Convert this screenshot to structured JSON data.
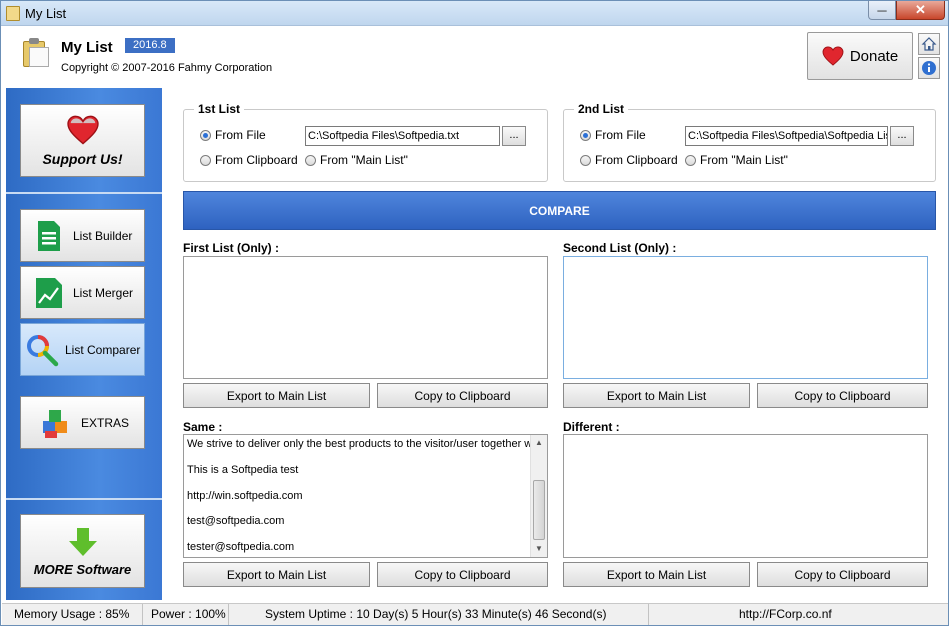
{
  "window": {
    "title": "My List",
    "minimize_glyph": "─",
    "close_glyph": "✕"
  },
  "header": {
    "app_name": "My List",
    "version": "2016.8",
    "copyright": "Copyright © 2007-2016 Fahmy Corporation",
    "donate_label": "Donate"
  },
  "sidebar": {
    "support_label": "Support Us!",
    "items": [
      {
        "label": "List Builder",
        "icon": "sheet-icon"
      },
      {
        "label": "List Merger",
        "icon": "chart-icon"
      },
      {
        "label": "List Comparer",
        "icon": "magnifier-icon",
        "active": true
      },
      {
        "label": "EXTRAS",
        "icon": "cubes-icon"
      }
    ],
    "more_label": "MORE Software"
  },
  "list1": {
    "title": "1st List",
    "from_file": "From File",
    "from_clipboard": "From Clipboard",
    "from_main": "From \"Main List\"",
    "path": "C:\\Softpedia Files\\Softpedia.txt",
    "browse": "..."
  },
  "list2": {
    "title": "2nd List",
    "from_file": "From File",
    "from_clipboard": "From Clipboard",
    "from_main": "From \"Main List\"",
    "path": "C:\\Softpedia Files\\Softpedia\\Softpedia List",
    "browse": "..."
  },
  "compare_label": "COMPARE",
  "first_only": {
    "label": "First List (Only) :",
    "export": "Export to Main List",
    "copy": "Copy to Clipboard"
  },
  "second_only": {
    "label": "Second List (Only) :",
    "export": "Export to Main List",
    "copy": "Copy to Clipboard"
  },
  "same": {
    "label": "Same :",
    "lines": [
      "We strive to deliver only the best products to the visitor/user together with",
      "This is a Softpedia test",
      "http://win.softpedia.com",
      "test@softpedia.com",
      "tester@softpedia.com"
    ],
    "export": "Export to Main List",
    "copy": "Copy to Clipboard"
  },
  "different": {
    "label": "Different :",
    "export": "Export to Main List",
    "copy": "Copy to Clipboard"
  },
  "status": {
    "memory": "Memory Usage : 85%",
    "power": "Power : 100%",
    "uptime": "System Uptime : 10 Day(s) 5 Hour(s) 33 Minute(s) 46 Second(s)",
    "url": "http://FCorp.co.nf"
  },
  "colors": {
    "accent": "#3c6fc4",
    "compare": "#3a6fcc",
    "sidebar": "#3b78d4"
  }
}
